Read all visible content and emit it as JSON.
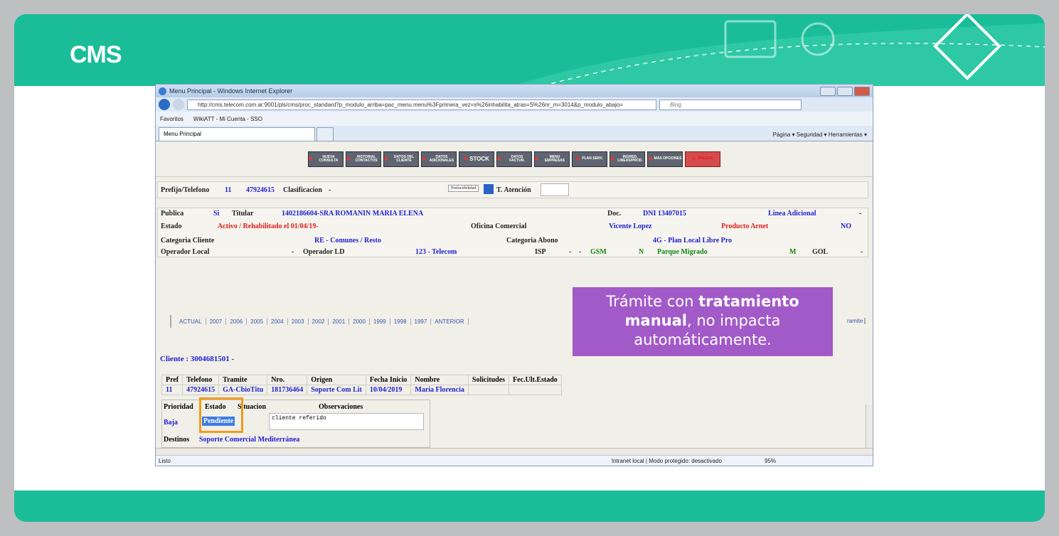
{
  "slide": {
    "brand": "CMS"
  },
  "browser": {
    "title": "Menu Principal - Windows Internet Explorer",
    "url": "http://cms.telecom.com.ar:9001/pls/cms/proc_standard?p_modulo_arriba=pac_menu.menu%3Fprimera_vez=s%26inhabilita_atras=S%26nr_m=3014&p_modulo_abajo=",
    "search_placeholder": "Bing",
    "favorites": [
      "Favoritos",
      "WikiATT - Mi Cuenta - SSO"
    ],
    "tab_label": "Menu Principal",
    "command_bar": "Página ▾   Seguridad ▾   Herramientas ▾",
    "status_left": "Listo",
    "status_zone": "Intranet local | Modo protegido: desactivado",
    "zoom": "95%"
  },
  "toolbar": [
    "NUEVA CONSULTA",
    "HISTORIAL CONTACTOS",
    "DATOS DEL CLIENTE",
    "DATOS ADICIONALES",
    "STOCK",
    "DATOS FACTUR.",
    "MENU EMPRESAS",
    "PLAN SERV.",
    "INGRED. LINEAS/PROD.",
    "MAS OPCIONES",
    "PRESUP."
  ],
  "header_row": {
    "prefijo_label": "Prefijo/Telefono",
    "prefijo": "11",
    "telefono": "47924615",
    "clasificacion_label": "Clasificacion",
    "clasificacion": "-",
    "prefactibilidad": "Prefactibilidad",
    "atencion_label": "T. Atención"
  },
  "info": {
    "publica_label": "Publica",
    "publica": "Si",
    "titular_label": "Titular",
    "titular": "1402186604-SRA ROMANIN MARIA ELENA",
    "doc_label": "Doc.",
    "doc": "DNI 13407015",
    "linea_adicional": "Linea Adicional",
    "dash": "-",
    "estado_label": "Estado",
    "estado": "Activo / Rehabilitado el 01/04/19-",
    "oficina_label": "Oficina Comercial",
    "oficina": "Vicente Lopez",
    "producto": "Producto Arnet",
    "producto_val": "NO",
    "categoria_label": "Categoria Cliente",
    "categoria": "RE - Comunes / Resto",
    "abono_label": "Categoria Abono",
    "abono": "4G - Plan Local Libre Pro",
    "op_local_label": "Operador Local",
    "op_local": "-",
    "op_ld_label": "Operador LD",
    "op_ld": "123 - Telecom",
    "isp_label": "ISP",
    "isp": "-",
    "isp2": "-",
    "gsm": "GSM",
    "n": "N",
    "parque": "Parque Migrado",
    "m": "M",
    "gol": "GOL",
    "gol_val": "-"
  },
  "years": [
    "ACTUAL",
    "2007",
    "2006",
    "2005",
    "2004",
    "2003",
    "2002",
    "2001",
    "2000",
    "1999",
    "1998",
    "1997",
    "ANTERIOR"
  ],
  "tramite_link": "ramite",
  "client_label": "Cliente : 3004681501 -",
  "tramite_table": {
    "headers": [
      "Pref",
      "Telefono",
      "Tramite",
      "Nro.",
      "Origen",
      "Fecha Inicio",
      "Nombre",
      "Solicitudes",
      "Fec.Ult.Estado"
    ],
    "row": [
      "11",
      "47924615",
      "GA-CbioTitu",
      "181736464",
      "Soporte Com Lit",
      "10/04/2019",
      "Maria Florencia",
      "",
      ""
    ]
  },
  "detail": {
    "prioridad_label": "Prioridad",
    "estado_label": "Estado",
    "situacion_label": "Situacion",
    "obs_label": "Observaciones",
    "prioridad": "Baja",
    "estado": "Pendiente",
    "observacion": "cliente referido",
    "destinos_label": "Destinos",
    "destinos": "Soporte Comercial Mediterránea"
  },
  "callout": {
    "line1": "Trámite con ",
    "bold1": "tratamiento",
    "bold2": "manual",
    "line2": ", no impacta",
    "line3": "automáticamente."
  },
  "colors": {
    "brand": "#1bbd99",
    "callout": "#a25ac8",
    "highlight": "#f29b1c"
  }
}
